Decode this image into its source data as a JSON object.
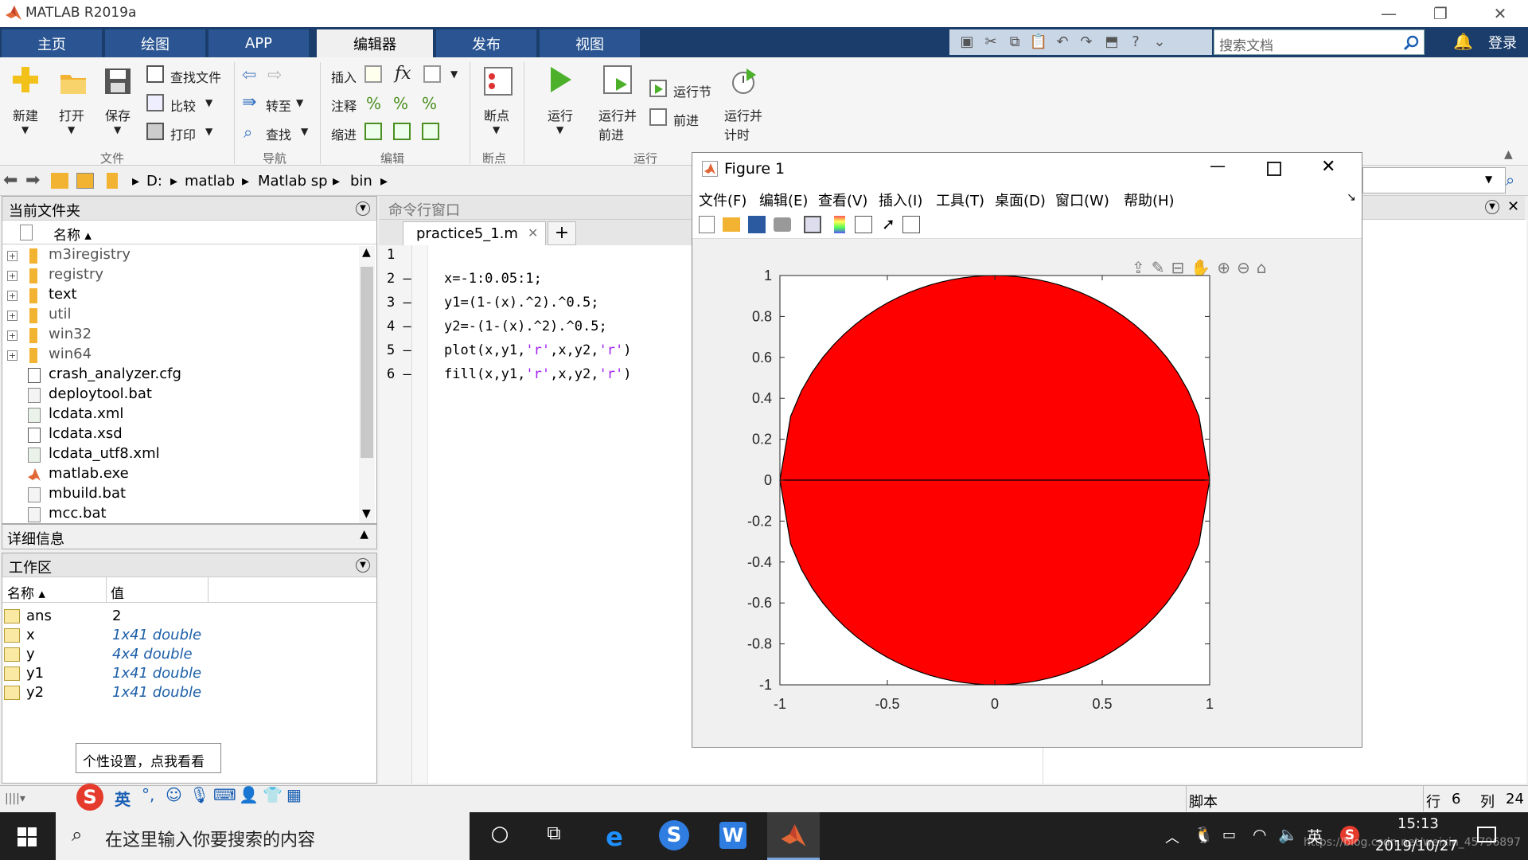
{
  "app": {
    "title": "MATLAB R2019a"
  },
  "tabs": [
    "主页",
    "绘图",
    "APP",
    "编辑器",
    "发布",
    "视图"
  ],
  "active_tab": "编辑器",
  "doc_search": {
    "placeholder": "搜索文档"
  },
  "login": "登录",
  "ribbon": {
    "new": "新建",
    "open": "打开",
    "save": "保存",
    "find_files": "查找文件",
    "compare": "比较",
    "print": "打印",
    "go_to": "转至",
    "find": "查找",
    "insert": "插入",
    "comment": "注释",
    "indent": "缩进",
    "breakpoints": "断点",
    "run": "运行",
    "run_advance_1": "运行并",
    "run_advance_2": "前进",
    "run_section": "运行节",
    "advance": "前进",
    "run_time_1": "运行并",
    "run_time_2": "计时",
    "groups": {
      "file": "文件",
      "nav": "导航",
      "edit": "编辑",
      "bp": "断点",
      "run": "运行"
    }
  },
  "path": {
    "drive": "D:",
    "p1": "matlab",
    "p2": "Matlab sp",
    "p3": "bin"
  },
  "current_folder": {
    "title": "当前文件夹",
    "col_name": "名称",
    "folders": [
      "m3iregistry",
      "registry",
      "text",
      "util",
      "win32",
      "win64"
    ],
    "files": [
      "crash_analyzer.cfg",
      "deploytool.bat",
      "lcdata.xml",
      "lcdata.xsd",
      "lcdata_utf8.xml",
      "matlab.exe",
      "mbuild.bat",
      "mcc.bat"
    ]
  },
  "details": {
    "title": "详细信息"
  },
  "workspace": {
    "title": "工作区",
    "col_name": "名称",
    "col_value": "值",
    "vars": [
      {
        "name": "ans",
        "value": "2"
      },
      {
        "name": "x",
        "value": "1x41 double"
      },
      {
        "name": "y",
        "value": "4x4 double"
      },
      {
        "name": "y1",
        "value": "1x41 double"
      },
      {
        "name": "y2",
        "value": "1x41 double"
      }
    ]
  },
  "command_window": {
    "title": "命令行窗口"
  },
  "editor": {
    "tab": "practice5_1.m",
    "lines": [
      {
        "n": "1",
        "dash": ""
      },
      {
        "n": "2",
        "dash": "—",
        "pre": "x=-1:0.05:1;",
        "s1": "",
        "m1": "",
        "s2": "",
        "end": ""
      },
      {
        "n": "3",
        "dash": "—",
        "pre": "y1=(1-(x).^2).^0.5;",
        "s1": "",
        "m1": "",
        "s2": "",
        "end": ""
      },
      {
        "n": "4",
        "dash": "—",
        "pre": "y2=-(1-(x).^2).^0.5;",
        "s1": "",
        "m1": "",
        "s2": "",
        "end": ""
      },
      {
        "n": "5",
        "dash": "—",
        "pre": "plot(x,y1,",
        "s1": "'r'",
        "m1": ",x,y2,",
        "s2": "'r'",
        "end": ")"
      },
      {
        "n": "6",
        "dash": "—",
        "pre": "fill(x,y1,",
        "s1": "'r'",
        "m1": ",x,y2,",
        "s2": "'r'",
        "end": ")"
      }
    ]
  },
  "figure": {
    "title": "Figure 1",
    "menus": [
      "文件(F)",
      "编辑(E)",
      "查看(V)",
      "插入(I)",
      "工具(T)",
      "桌面(D)",
      "窗口(W)",
      "帮助(H)"
    ],
    "fill_color": "#ff0000"
  },
  "chart_data": {
    "type": "area",
    "x": [
      -1,
      -0.95,
      -0.9,
      -0.85,
      -0.8,
      -0.75,
      -0.7,
      -0.65,
      -0.6,
      -0.55,
      -0.5,
      -0.45,
      -0.4,
      -0.35,
      -0.3,
      -0.25,
      -0.2,
      -0.15,
      -0.1,
      -0.05,
      0,
      0.05,
      0.1,
      0.15,
      0.2,
      0.25,
      0.3,
      0.35,
      0.4,
      0.45,
      0.5,
      0.55,
      0.6,
      0.65,
      0.7,
      0.75,
      0.8,
      0.85,
      0.9,
      0.95,
      1
    ],
    "series": [
      {
        "expr": "y1=(1-(x).^2).^0.5",
        "color": "#ff0000"
      },
      {
        "expr": "y2=-(1-(x).^2).^0.5",
        "color": "#ff0000"
      }
    ],
    "xlim": [
      -1,
      1
    ],
    "ylim": [
      -1,
      1
    ],
    "xticks": [
      "-1",
      "-0.5",
      "0",
      "0.5",
      "1"
    ],
    "yticks": [
      "1",
      "0.8",
      "0.6",
      "0.4",
      "0.2",
      "0",
      "-0.2",
      "-0.4",
      "-0.6",
      "-0.8",
      "-1"
    ],
    "grid": false
  },
  "status": {
    "mode": "脚本",
    "row_label": "行",
    "row": "6",
    "col_label": "列",
    "col": "24"
  },
  "ime": {
    "tooltip": "个性设置，点我看看",
    "lang": "英"
  },
  "taskbar": {
    "search": "在这里输入你要搜索的内容",
    "time": "15:13",
    "date": "2019/10/27",
    "watermark": "https://blog.csdn.net/weixin_45796897",
    "lang": "英"
  }
}
